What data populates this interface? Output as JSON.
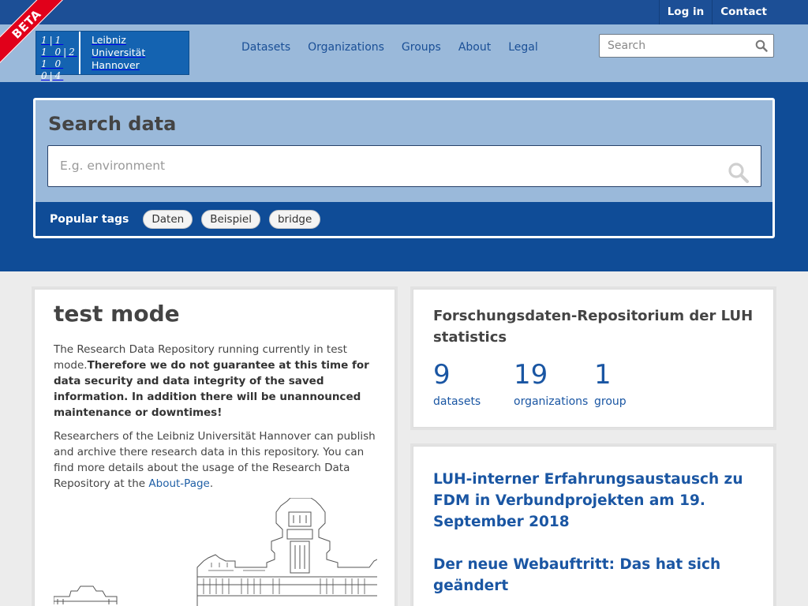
{
  "beta": "BETA",
  "account": {
    "login": "Log in",
    "contact": "Contact"
  },
  "logo": {
    "mark_line1": "1|1",
    "mark_line2": "1 0|2",
    "mark_line3": "1 0 0|4",
    "text": [
      "Leibniz",
      "Universität",
      "Hannover"
    ]
  },
  "nav": [
    "Datasets",
    "Organizations",
    "Groups",
    "About",
    "Legal"
  ],
  "site_search": {
    "placeholder": "Search"
  },
  "hero": {
    "title": "Search data",
    "placeholder": "E.g. environment",
    "tags_label": "Popular tags",
    "tags": [
      "Daten",
      "Beispiel",
      "bridge"
    ]
  },
  "notice": {
    "title": "test mode",
    "intro_plain": "The Research Data Repository running currently in test mode.",
    "intro_bold": "Therefore we do not guarantee at this time for data security and data integrity of the saved information. In addition there will be unannounced maintenance or downtimes!",
    "body": "Researchers of the Leibniz Universität Hannover can publish and archive there research data in this repository. You can find more details about the usage of the Research Data Repository at the ",
    "link": "About-Page",
    "body_end": "."
  },
  "stats": {
    "title": "Forschungsdaten-Repositorium der LUH statistics",
    "items": [
      {
        "value": "9",
        "label": "datasets"
      },
      {
        "value": "19",
        "label": "organizations"
      },
      {
        "value": "1",
        "label": "group"
      }
    ]
  },
  "news": [
    "LUH-interner Erfahrungsaustausch zu FDM in Verbundprojekten am 19. September 2018",
    "Der neue Webauftritt: Das hat sich geändert"
  ],
  "colors": {
    "header": "#1c4f96",
    "masthead": "#9ab9da",
    "hero": "#0f4c97",
    "link": "#1a56a3",
    "beta": "#e1001a"
  }
}
